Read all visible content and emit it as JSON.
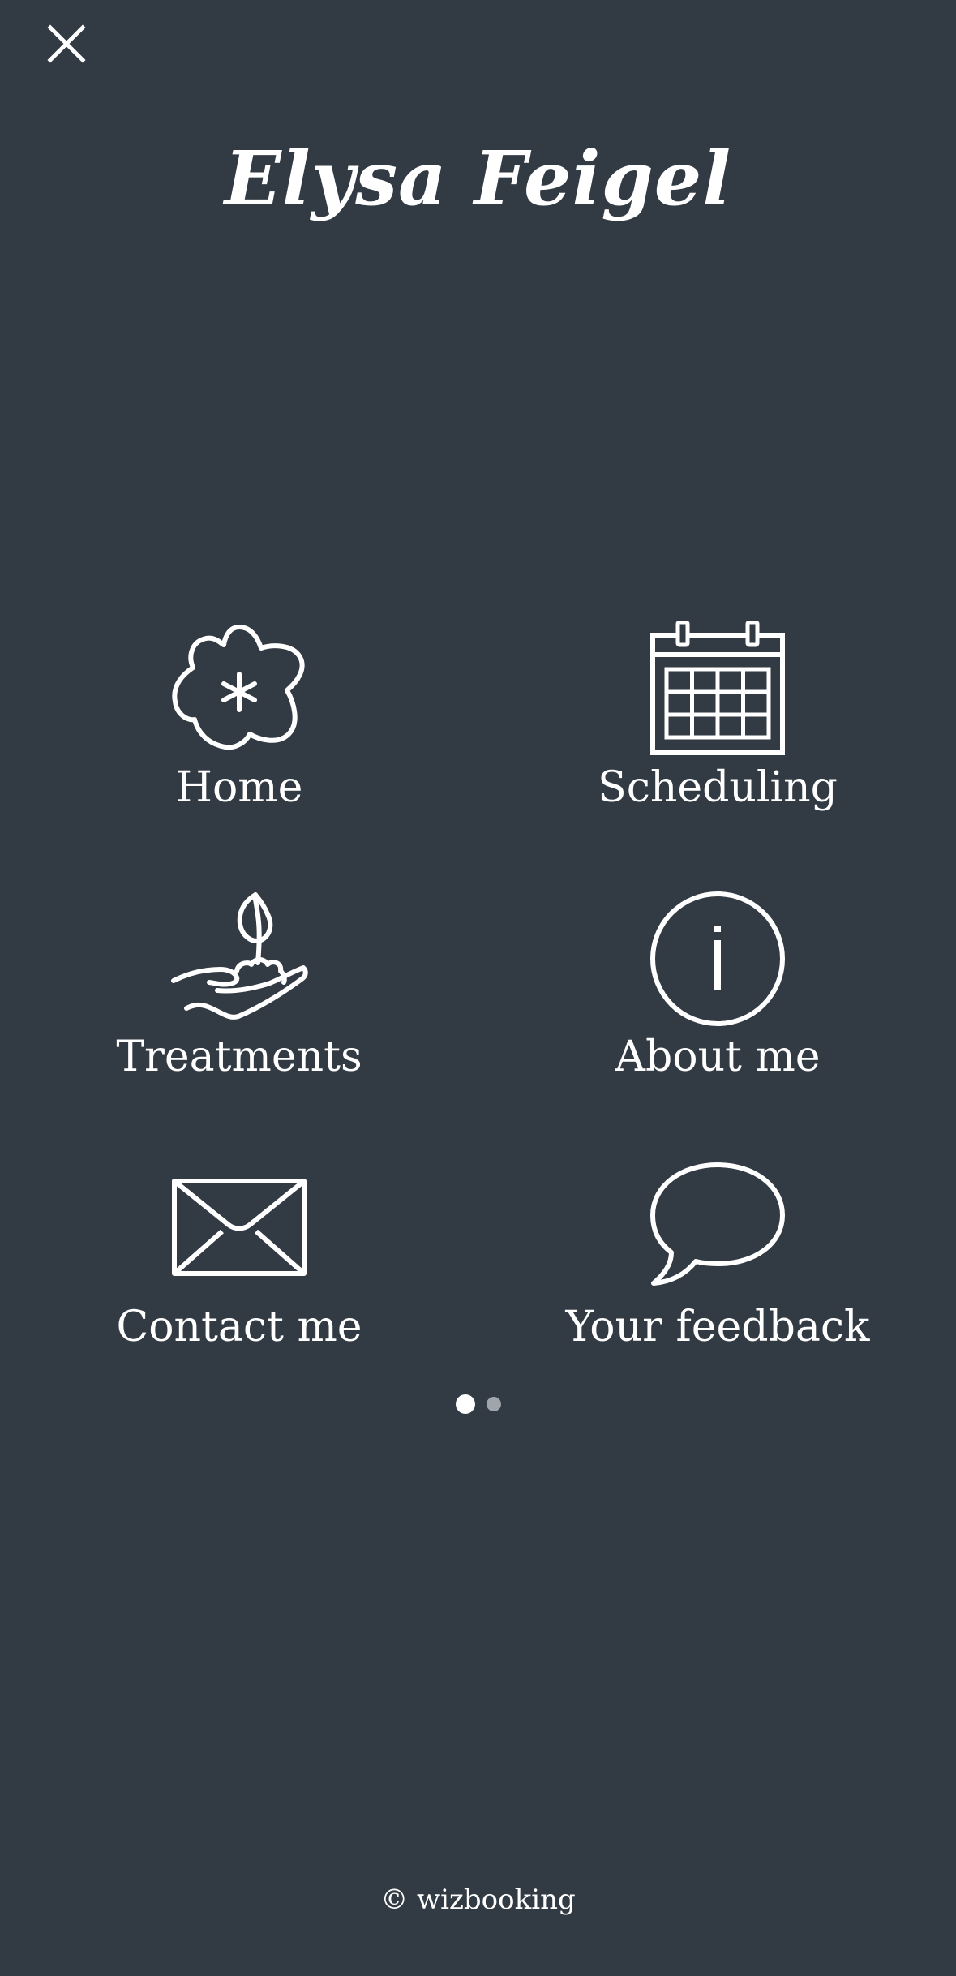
{
  "header": {
    "close_icon": "close-icon",
    "title": "Elysa Feigel"
  },
  "menu": {
    "items": [
      {
        "label": "Home",
        "icon": "flower-icon"
      },
      {
        "label": "Scheduling",
        "icon": "calendar-icon"
      },
      {
        "label": "Treatments",
        "icon": "hand-plant-icon"
      },
      {
        "label": "About me",
        "icon": "info-icon"
      },
      {
        "label": "Contact me",
        "icon": "envelope-icon"
      },
      {
        "label": "Your feedback",
        "icon": "speech-bubble-icon"
      }
    ]
  },
  "pagination": {
    "current_page": 1,
    "total_pages": 2
  },
  "footer": {
    "text": "© wizbooking"
  },
  "colors": {
    "background": "#323a43",
    "foreground": "#ffffff",
    "inactive_dot": "#a0a5ab"
  }
}
